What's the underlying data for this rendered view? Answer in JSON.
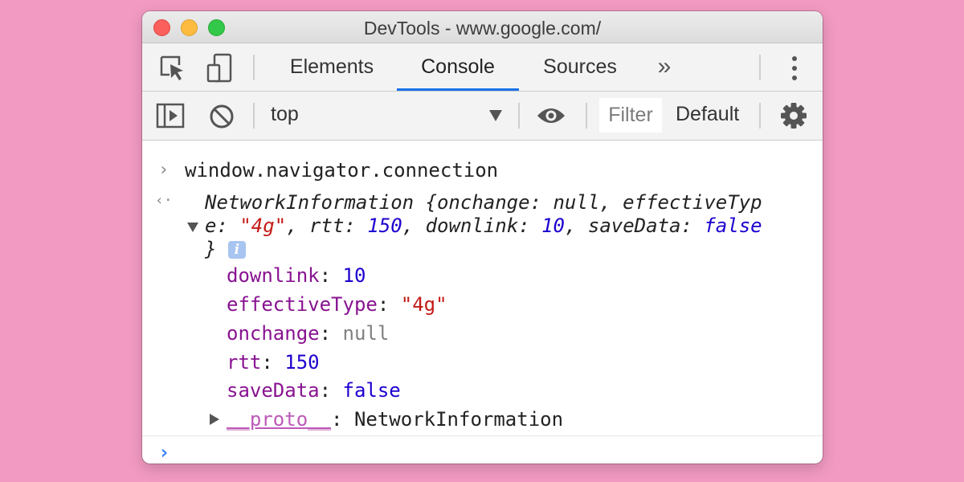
{
  "window": {
    "title": "DevTools - www.google.com/"
  },
  "tabs": [
    {
      "label": "Elements",
      "active": false
    },
    {
      "label": "Console",
      "active": true
    },
    {
      "label": "Sources",
      "active": false
    }
  ],
  "tabbar": {
    "more_tabs": "»"
  },
  "toolbar": {
    "context": "top",
    "filter_placeholder": "Filter",
    "levels": "Default"
  },
  "console": {
    "input_command": "window.navigator.connection",
    "result": {
      "summary_line1": "NetworkInformation {onchange: null, effectiveTyp",
      "summary_line2_e": "e: ",
      "summary_effective_value": "\"4g\"",
      "summary_rtt_key": ", rtt: ",
      "summary_rtt_value": "150",
      "summary_downlink_key": ", downlink: ",
      "summary_downlink_value": "10",
      "summary_savedata_key": ", saveData: ",
      "summary_savedata_value": "false",
      "summary_close": "}",
      "info_badge": "i"
    },
    "properties": [
      {
        "key": "downlink",
        "value": "10",
        "type": "num"
      },
      {
        "key": "effectiveType",
        "value": "\"4g\"",
        "type": "str"
      },
      {
        "key": "onchange",
        "value": "null",
        "type": "nul"
      },
      {
        "key": "rtt",
        "value": "150",
        "type": "num"
      },
      {
        "key": "saveData",
        "value": "false",
        "type": "bool"
      }
    ],
    "proto": {
      "key": "__proto__",
      "value": "NetworkInformation"
    },
    "prompt_symbol": "›",
    "result_symbol": "‹·"
  },
  "colors": {
    "background": "#f29ac2",
    "active_tab": "#1a73e8",
    "key": "#881391",
    "number": "#1c00cf",
    "string": "#c41a16"
  }
}
